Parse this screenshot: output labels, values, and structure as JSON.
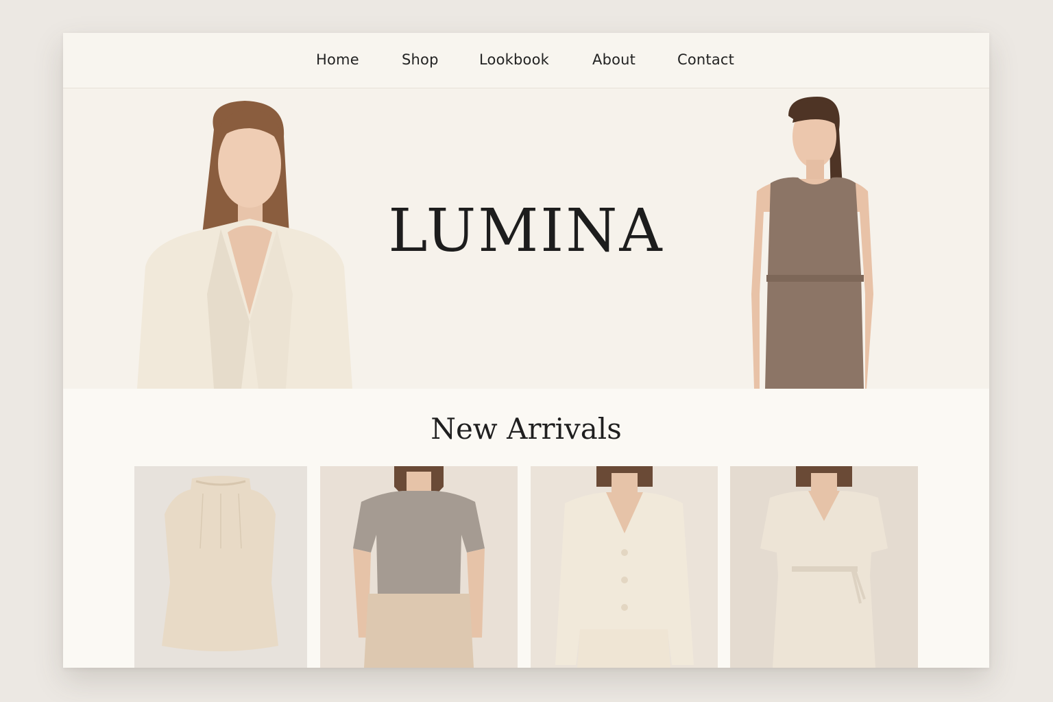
{
  "nav": {
    "items": [
      {
        "label": "Home"
      },
      {
        "label": "Shop"
      },
      {
        "label": "Lookbook"
      },
      {
        "label": "About"
      },
      {
        "label": "Contact"
      }
    ]
  },
  "hero": {
    "brand": "LUMINA"
  },
  "arrivals": {
    "title": "New Arrivals",
    "products": [
      {
        "image": "sleeveless-blouse-photo"
      },
      {
        "image": "tshirt-trousers-photo"
      },
      {
        "image": "cardigan-photo"
      },
      {
        "image": "wrap-dress-photo"
      }
    ]
  },
  "colors": {
    "background": "#f8f5ef",
    "text": "#1d1d1d",
    "beige": "#e9dcc8",
    "taupe": "#8b7564",
    "cream": "#efe6d6"
  }
}
